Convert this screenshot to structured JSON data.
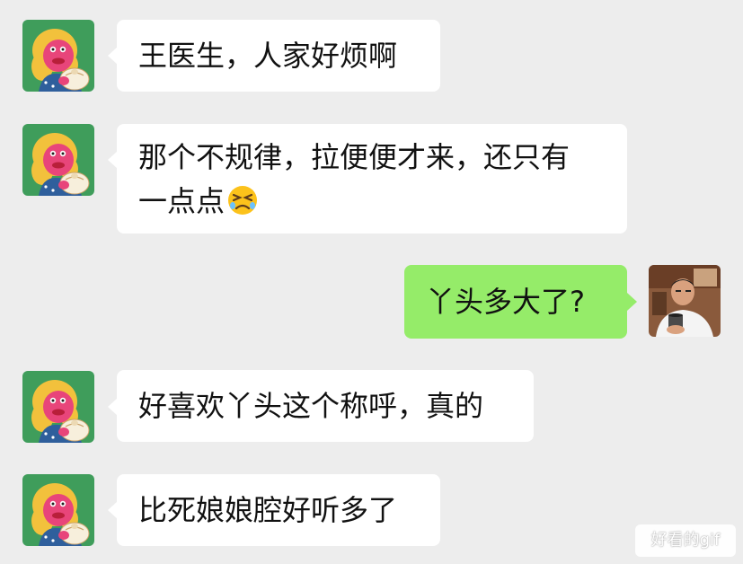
{
  "messages": [
    {
      "sender": "patient",
      "text": "王医生，人家好烦啊"
    },
    {
      "sender": "patient",
      "text": "那个不规律，拉便便才来，还只有",
      "text2": "一点点",
      "emoji": "persevering-face-emoji"
    },
    {
      "sender": "doctor",
      "text": "丫头多大了?"
    },
    {
      "sender": "patient",
      "text": "好喜欢丫头这个称呼，真的"
    },
    {
      "sender": "patient",
      "text": "比死娘娘腔好听多了"
    }
  ],
  "watermark": "好看的gif",
  "colors": {
    "background": "#ededed",
    "incoming_bubble": "#ffffff",
    "outgoing_bubble": "#95ec69",
    "patient_avatar_bg": "#3f9d5b"
  },
  "icons": {
    "patient_avatar": "cartoon-girl-with-bun-avatar",
    "doctor_avatar": "man-with-cup-photo-avatar"
  }
}
